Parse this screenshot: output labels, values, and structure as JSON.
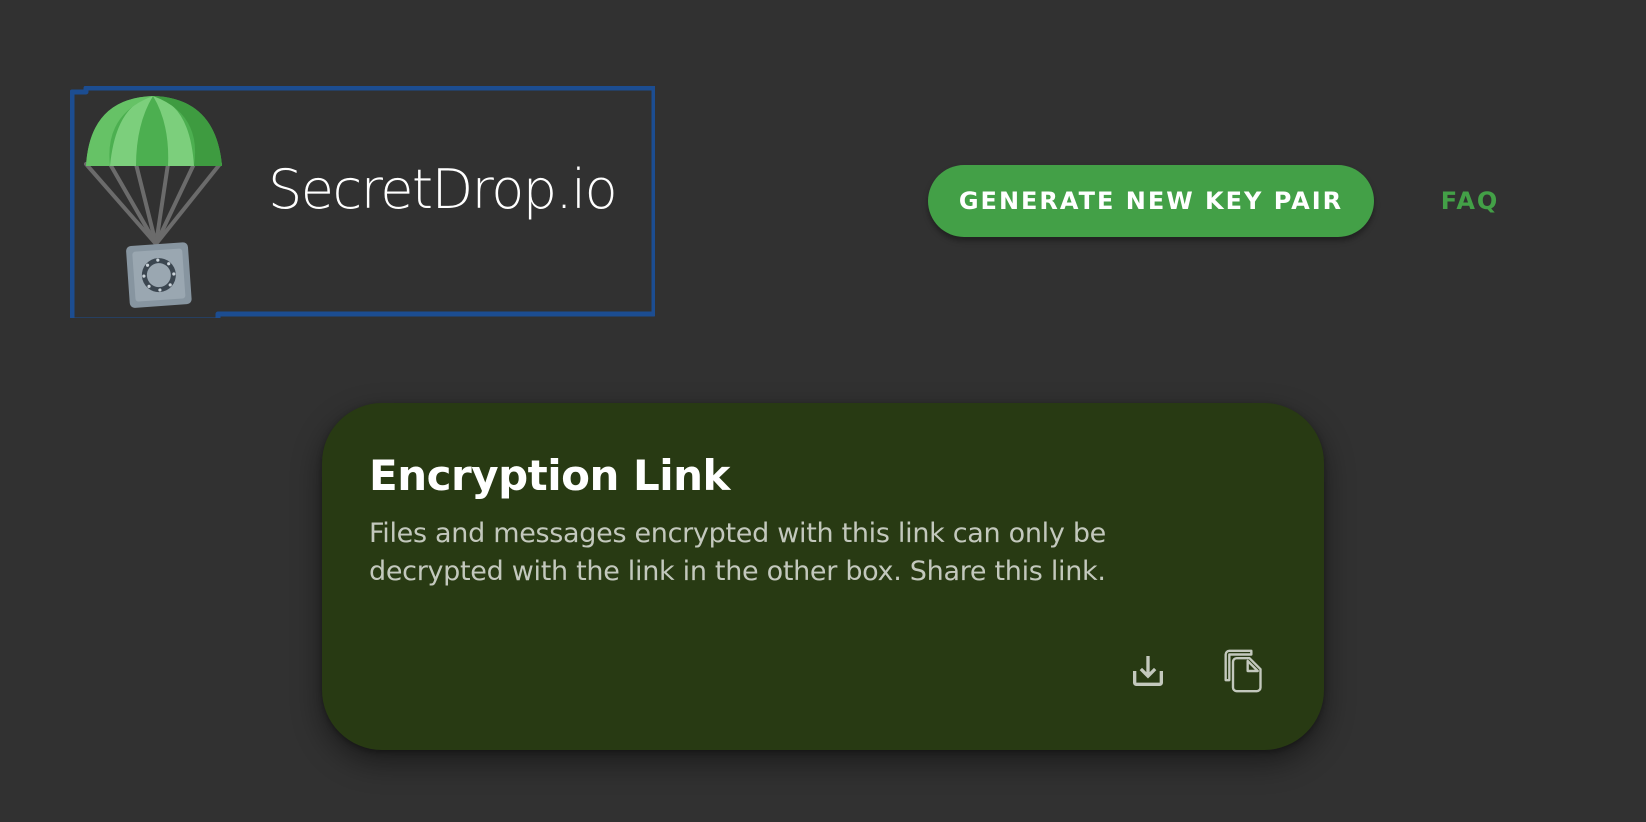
{
  "header": {
    "logo_text": "SecretDrop.io",
    "generate_button_label": "GENERATE NEW KEY PAIR",
    "faq_label": "FAQ"
  },
  "card": {
    "title": "Encryption Link",
    "description": "Files and messages encrypted with this link can only be decrypted with the link in the other box. Share this link.",
    "actions": [
      {
        "icon": "download-icon"
      },
      {
        "icon": "copy-icon"
      }
    ]
  },
  "colors": {
    "page_background": "#313131",
    "accent_green": "#43a047",
    "card_background": "#283a13",
    "focus_outline": "#1c4d91",
    "icon_color": "#c3c8bd"
  }
}
